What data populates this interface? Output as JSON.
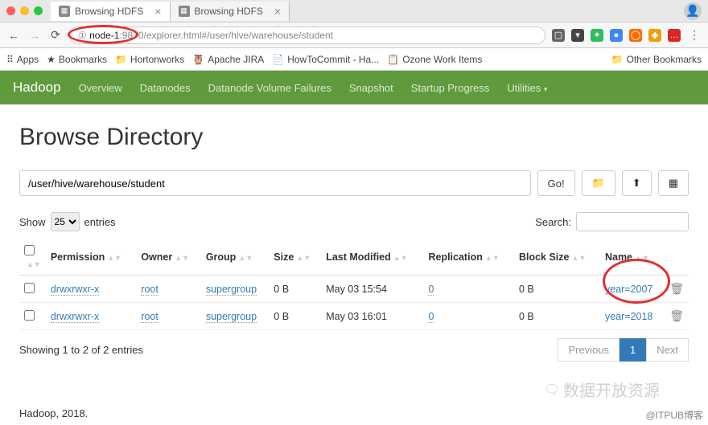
{
  "browser": {
    "tabs": [
      {
        "title": "Browsing HDFS",
        "active": true
      },
      {
        "title": "Browsing HDFS",
        "active": false
      }
    ],
    "url_host": "node-1",
    "url_port": ":9870",
    "url_path": "/explorer.html#/user/hive/warehouse/student",
    "bookmarks": {
      "apps": "Apps",
      "items": [
        "Bookmarks",
        "Hortonworks",
        "Apache JIRA",
        "HowToCommit - Ha...",
        "Ozone Work Items"
      ],
      "other": "Other Bookmarks"
    }
  },
  "nav": {
    "brand": "Hadoop",
    "items": [
      "Overview",
      "Datanodes",
      "Datanode Volume Failures",
      "Snapshot",
      "Startup Progress",
      "Utilities"
    ]
  },
  "page": {
    "title": "Browse Directory",
    "path": "/user/hive/warehouse/student",
    "go": "Go!",
    "show": "Show",
    "entries_label": "entries",
    "entries_value": "25",
    "search_label": "Search:",
    "columns": [
      "",
      "Permission",
      "Owner",
      "Group",
      "Size",
      "Last Modified",
      "Replication",
      "Block Size",
      "Name",
      ""
    ],
    "rows": [
      {
        "perm": "drwxrwxr-x",
        "owner": "root",
        "group": "supergroup",
        "size": "0 B",
        "mod": "May 03 15:54",
        "rep": "0",
        "bs": "0 B",
        "name": "year=2007"
      },
      {
        "perm": "drwxrwxr-x",
        "owner": "root",
        "group": "supergroup",
        "size": "0 B",
        "mod": "May 03 16:01",
        "rep": "0",
        "bs": "0 B",
        "name": "year=2018"
      }
    ],
    "showing": "Showing 1 to 2 of 2 entries",
    "prev": "Previous",
    "page1": "1",
    "next": "Next",
    "footer": "Hadoop, 2018."
  },
  "watermark": {
    "text": "数据开放资源",
    "sub": "@ITPUB博客"
  }
}
